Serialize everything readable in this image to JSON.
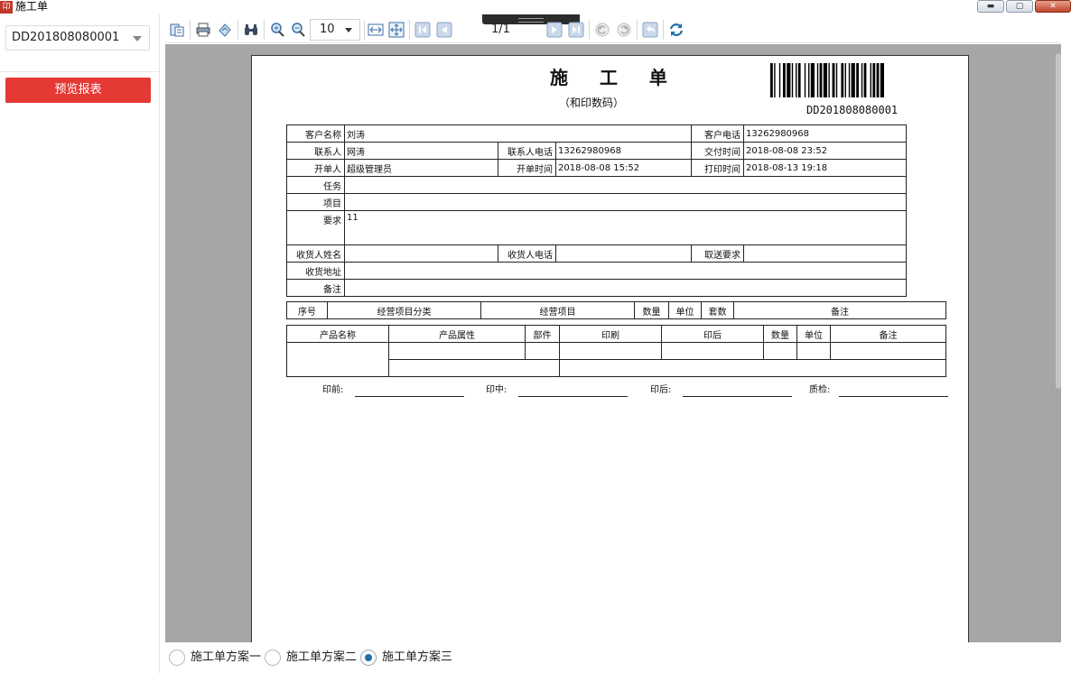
{
  "window": {
    "title": "施工单",
    "app_icon_glyph": "卬",
    "min_label": "▬",
    "max_label": "▢",
    "close_label": "✕"
  },
  "sidebar": {
    "order_select_value": "DD201808080001",
    "preview_button": "预览报表"
  },
  "toolbar": {
    "zoom_value": "10",
    "page_indicator": "1/1"
  },
  "document": {
    "title": "施 工 单",
    "subtitle": "（和印数码）",
    "barcode_text": "DD201808080001",
    "info": {
      "customer_name_label": "客户名称",
      "customer_name_value": "刘涛",
      "customer_phone_label": "客户电话",
      "customer_phone_value": "13262980968",
      "contact_label": "联系人",
      "contact_value": "网涛",
      "contact_phone_label": "联系人电话",
      "contact_phone_value": "13262980968",
      "delivery_time_label": "交付时间",
      "delivery_time_value": "2018-08-08 23:52",
      "issuer_label": "开单人",
      "issuer_value": "超级管理员",
      "issue_time_label": "开单时间",
      "issue_time_value": "2018-08-08 15:52",
      "print_time_label": "打印时间",
      "print_time_value": "2018-08-13 19:18",
      "task_label": "任务",
      "project_label": "项目",
      "requirement_label": "要求",
      "requirement_value": "11",
      "receiver_name_label": "收货人姓名",
      "receiver_phone_label": "收货人电话",
      "pickup_label": "取送要求",
      "receiver_address_label": "收货地址",
      "remark_label": "备注"
    },
    "items_headers": [
      "序号",
      "经营项目分类",
      "经营项目",
      "数量",
      "单位",
      "套数",
      "备注"
    ],
    "products_headers": [
      "产品名称",
      "产品属性",
      "部件",
      "印刷",
      "印后",
      "数量",
      "单位",
      "备注"
    ],
    "signatures": [
      "印前:",
      "印中:",
      "印后:",
      "质检:"
    ]
  },
  "schemes": [
    {
      "label": "施工单方案一",
      "checked": false
    },
    {
      "label": "施工单方案二",
      "checked": false
    },
    {
      "label": "施工单方案三",
      "checked": true
    }
  ],
  "colors": {
    "preview_button": "#e53935",
    "canvas_bg": "#a6a6a6",
    "radio_selected": "#1e6fa8"
  }
}
